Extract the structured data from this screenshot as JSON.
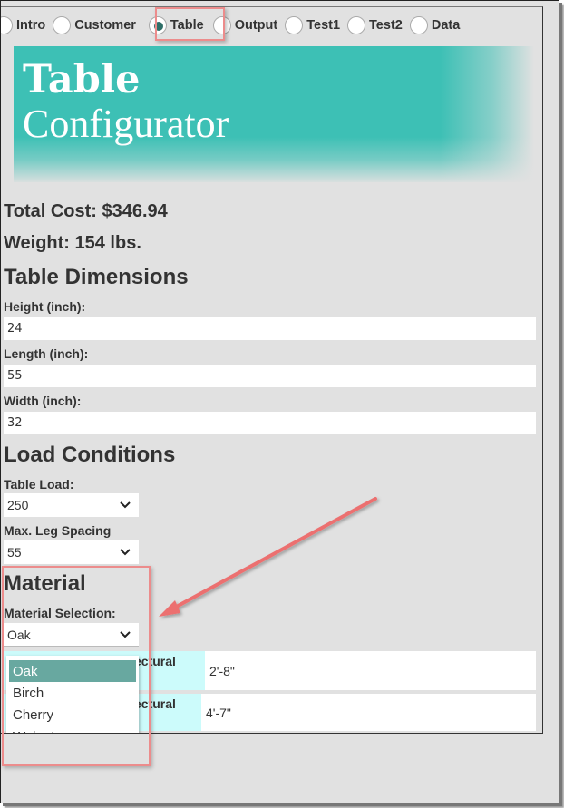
{
  "nav": {
    "tabs": [
      {
        "label": "Intro",
        "checked": false
      },
      {
        "label": "Customer",
        "checked": false
      },
      {
        "label": "Table",
        "checked": true
      },
      {
        "label": "Output",
        "checked": false
      },
      {
        "label": "Test1",
        "checked": false
      },
      {
        "label": "Test2",
        "checked": false
      },
      {
        "label": "Data",
        "checked": false
      }
    ]
  },
  "banner": {
    "line1": "Table",
    "line2": "Configurator",
    "color": "#3dc0b5"
  },
  "summary": {
    "total_cost": "Total Cost: $346.94",
    "weight": "Weight: 154 lbs."
  },
  "dimensions": {
    "heading": "Table Dimensions",
    "height_label": "Height (inch):",
    "height_value": "24",
    "length_label": "Length (inch):",
    "length_value": "55",
    "width_label": "Width (inch):",
    "width_value": "32"
  },
  "load": {
    "heading": "Load Conditions",
    "table_load_label": "Table Load:",
    "table_load_value": "250",
    "leg_spacing_label": "Max. Leg Spacing",
    "leg_spacing_value": "55"
  },
  "material": {
    "heading": "Material",
    "selection_label": "Material Selection:",
    "selected_value": "Oak",
    "options": [
      "Oak",
      "Birch",
      "Cherry",
      "Walnut"
    ],
    "highlight_color": "#68a8a0"
  },
  "results": {
    "rows": [
      {
        "header_line1": "ectural",
        "header_line2": ")",
        "value": "2'-8\""
      },
      {
        "header_line1": "ectural",
        "header_line2": "",
        "value": "4'-7\""
      }
    ]
  },
  "annotations": {
    "color": "#ec8c8c"
  }
}
